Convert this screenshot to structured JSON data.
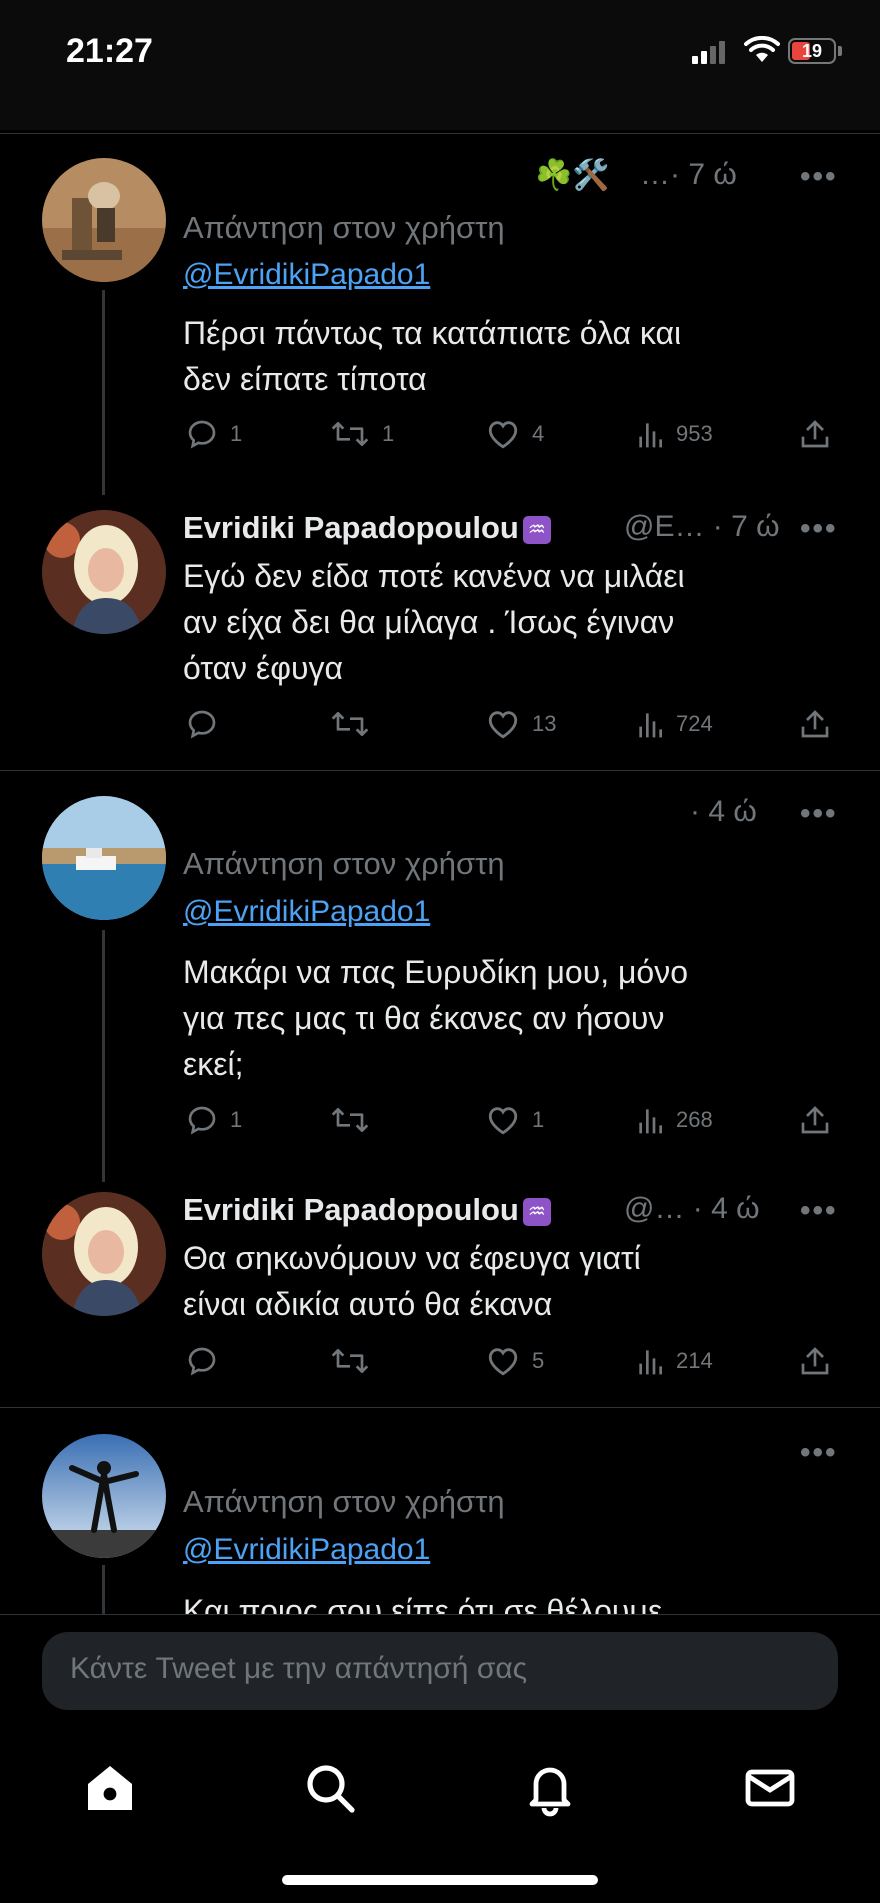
{
  "status_bar": {
    "time": "21:27",
    "battery": "19"
  },
  "tweets": [
    {
      "name_emoji": "☘️🛠️",
      "time": "…· 7 ώ",
      "reply_label": "Απάντηση στον χρήστη",
      "mention": "@EvridikiPapado1",
      "text_lines": [
        "Πέρσι πάντως τα κατάπιατε όλα και",
        "δεν είπατε τίποτα"
      ],
      "replies": "1",
      "retweets": "1",
      "likes": "4",
      "views": "953"
    },
    {
      "name": "Evridiki Papadopoulou",
      "handle_time": "@E… · 7 ώ",
      "text_lines": [
        "Εγώ δεν είδα ποτέ κανένα να μιλάει",
        "αν είχα δει θα μίλαγα . Ίσως έγιναν",
        "όταν έφυγα"
      ],
      "replies": "",
      "retweets": "",
      "likes": "13",
      "views": "724"
    },
    {
      "time": "· 4 ώ",
      "reply_label": "Απάντηση στον χρήστη",
      "mention": "@EvridikiPapado1",
      "text_lines": [
        "Μακάρι να πας Ευρυδίκη μου, μόνο",
        "για πες μας τι θα έκανες αν ήσουν",
        "εκεί;"
      ],
      "replies": "1",
      "retweets": "",
      "likes": "1",
      "views": "268"
    },
    {
      "name": "Evridiki Papadopoulou",
      "handle_time": "@… · 4 ώ",
      "text_lines": [
        "Θα σηκωνόμουν να έφευγα γιατί",
        "είναι αδικία αυτό θα έκανα"
      ],
      "replies": "",
      "retweets": "",
      "likes": "5",
      "views": "214"
    },
    {
      "reply_label": "Απάντηση στον χρήστη",
      "mention": "@EvridikiPapado1",
      "text_lines": [
        "Και ποιος σου είπε ότι σε θέλουμε"
      ]
    }
  ],
  "zodiac_glyph": "♒",
  "more_label": "•••",
  "composer_placeholder": "Κάντε Tweet με την απάντησή σας",
  "nav": [
    "home-icon",
    "search-icon",
    "notifications-icon",
    "messages-icon"
  ]
}
